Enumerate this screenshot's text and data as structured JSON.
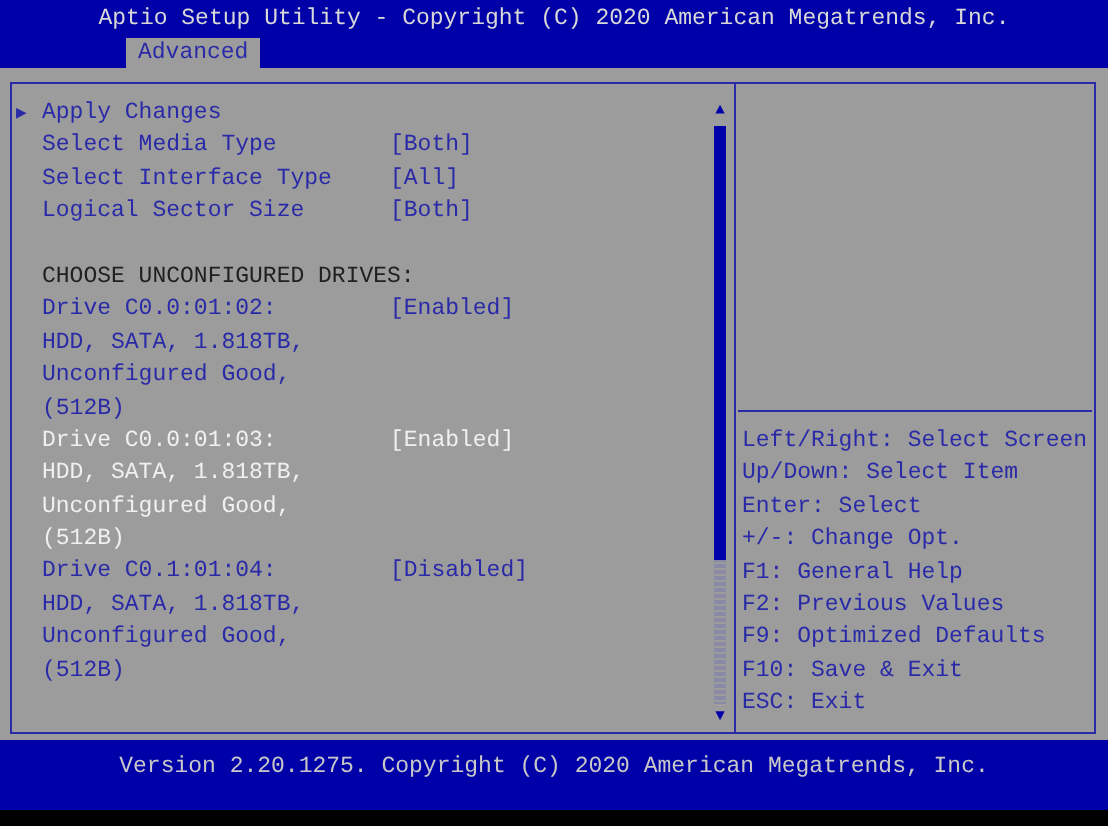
{
  "title": "Aptio Setup Utility - Copyright (C) 2020 American Megatrends, Inc.",
  "tabs": [
    {
      "label": "Advanced",
      "selected": true
    }
  ],
  "items": [
    {
      "kind": "action",
      "marker": "▶",
      "label": "Apply Changes",
      "selected": false
    },
    {
      "kind": "setting",
      "label": "Select Media Type",
      "value": "[Both]",
      "selected": false
    },
    {
      "kind": "setting",
      "label": "Select Interface Type",
      "value": "[All]",
      "selected": false
    },
    {
      "kind": "setting",
      "label": "Logical Sector Size",
      "value": "[Both]",
      "selected": false
    },
    {
      "kind": "heading",
      "label": "CHOOSE UNCONFIGURED DRIVES:"
    },
    {
      "kind": "drive",
      "label": "Drive C0.0:01:02:",
      "value": "[Enabled]",
      "details": [
        "HDD, SATA, 1.818TB,",
        "Unconfigured Good,",
        "(512B)"
      ],
      "selected": false
    },
    {
      "kind": "drive",
      "label": "Drive C0.0:01:03:",
      "value": "[Enabled]",
      "details": [
        "HDD, SATA, 1.818TB,",
        "Unconfigured Good,",
        "(512B)"
      ],
      "selected": true
    },
    {
      "kind": "drive",
      "label": "Drive C0.1:01:04:",
      "value": "[Disabled]",
      "details": [
        "HDD, SATA, 1.818TB,",
        "Unconfigured Good,",
        "(512B)"
      ],
      "selected": false
    }
  ],
  "scrollbar": {
    "up": "▲",
    "down": "▼"
  },
  "help": [
    "Left/Right: Select Screen",
    "Up/Down: Select Item",
    "Enter: Select",
    "+/-: Change Opt.",
    "F1: General Help",
    "F2: Previous Values",
    "F9: Optimized Defaults",
    "F10: Save & Exit",
    "ESC: Exit"
  ],
  "footer": "Version 2.20.1275. Copyright (C) 2020 American Megatrends, Inc."
}
